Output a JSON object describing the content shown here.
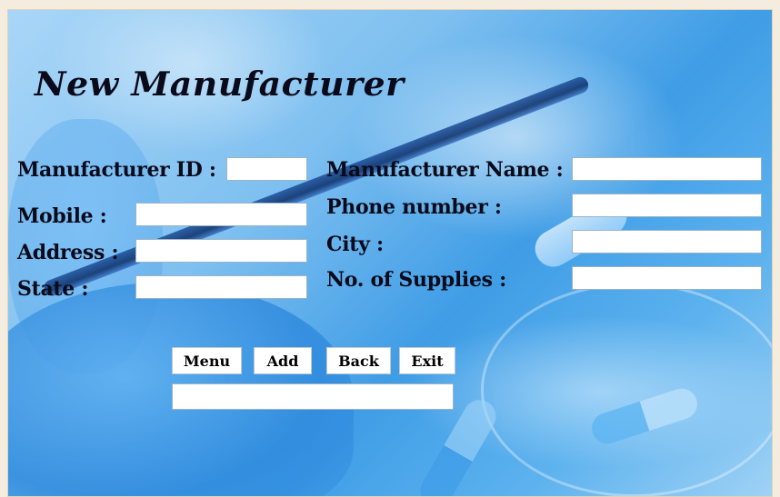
{
  "form": {
    "title": "New Manufacturer",
    "labels": {
      "manufacturer_id": "Manufacturer ID :",
      "manufacturer_name": "Manufacturer Name :",
      "mobile": "Mobile :",
      "phone_number": "Phone number :",
      "address": "Address :",
      "city": "City :",
      "state": "State :",
      "no_of_supplies": "No. of Supplies :"
    },
    "values": {
      "manufacturer_id": "",
      "manufacturer_name": "",
      "mobile": "",
      "phone_number": "",
      "address": "",
      "city": "",
      "state": "",
      "no_of_supplies": "",
      "status": ""
    }
  },
  "buttons": {
    "menu": "Menu",
    "add": "Add",
    "back": "Back",
    "exit": "Exit"
  }
}
